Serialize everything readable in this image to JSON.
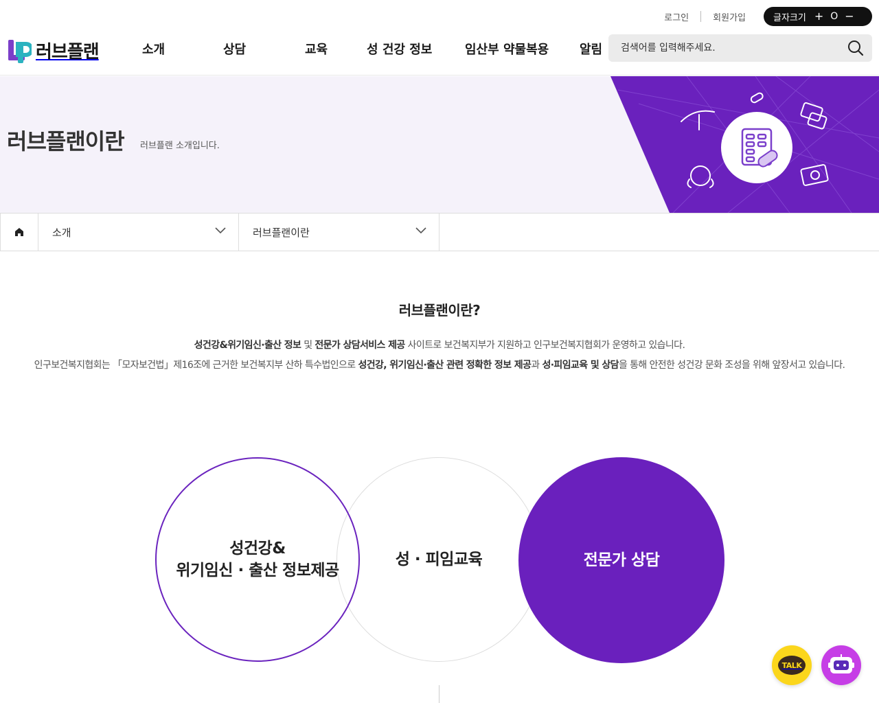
{
  "util": {
    "login": "로그인",
    "join": "회원가입",
    "font_size_label": "글자크기",
    "font_plus": "+",
    "font_reset": "O",
    "font_minus": "−"
  },
  "header": {
    "logo_text": "러브플랜",
    "nav": [
      "소개",
      "상담",
      "교육",
      "성 건강 정보",
      "임산부 약물복용",
      "알림"
    ],
    "search_placeholder": "검색어를 입력해주세요."
  },
  "visual": {
    "title": "러브플랜이란",
    "subtitle": "러브플랜 소개입니다.",
    "accent_color": "#6a20bd"
  },
  "location": {
    "depth1": "소개",
    "depth2": "러브플랜이란"
  },
  "intro": {
    "title": "러브플랜이란?",
    "line1_b1": "성건강&위기임신·출산 정보",
    "line1_t1": " 및 ",
    "line1_b2": "전문가 상담서비스 제공",
    "line1_t2": " 사이트로 보건복지부가 지원하고 인구보건복지협회가 운영하고 있습니다.",
    "line2_t1": "인구보건복지협회는 「모자보건법」제16조에 근거한 보건복지부 산하 특수법인으로 ",
    "line2_b1": "성건강, 위기임신·출산 관련 정확한 정보 제공",
    "line2_t2": "과 ",
    "line2_b2": "성·피임교육 및 상담",
    "line2_t3": "을 통해 안전한 성건강 문화 조성을 위해 앞장서고 있습니다."
  },
  "circles": {
    "c1_line1": "성건강&",
    "c1_line2": "위기임신 · 출산 정보제공",
    "c2": "성 · 피임교육",
    "c3": "전문가 상담"
  },
  "floating": {
    "talk_label": "TALK"
  },
  "icons": [
    "home-icon",
    "chevron-down-icon",
    "search-icon",
    "kakao-talk-icon",
    "chatbot-icon"
  ]
}
